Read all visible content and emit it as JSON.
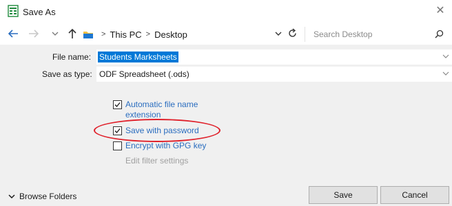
{
  "window": {
    "title": "Save As",
    "close_glyph": "✕"
  },
  "nav": {
    "breadcrumbs": [
      "This PC",
      "Desktop"
    ],
    "separator": ">",
    "search_placeholder": "Search Desktop"
  },
  "form": {
    "file_name_label": "File name:",
    "file_name_value": "Students Marksheets",
    "save_as_type_label": "Save as type:",
    "save_as_type_value": "ODF Spreadsheet (.ods)"
  },
  "options": [
    {
      "label_line1": "Automatic file name",
      "label_line2": "extension",
      "checked": true,
      "enabled": true
    },
    {
      "label": "Save with password",
      "checked": true,
      "enabled": true
    },
    {
      "label": "Encrypt with GPG key",
      "checked": false,
      "enabled": true
    },
    {
      "label": "Edit filter settings",
      "checked": false,
      "enabled": false
    }
  ],
  "footer": {
    "browse_folders_label": "Browse Folders",
    "save_label": "Save",
    "cancel_label": "Cancel"
  },
  "colors": {
    "accent_selection": "#0078d7",
    "option_link": "#2a6dbf",
    "annotation_oval": "#e0202a",
    "panel_bg": "#f0f0f0"
  }
}
